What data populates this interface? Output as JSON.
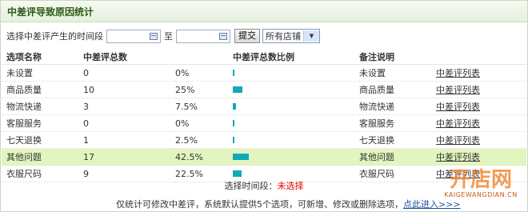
{
  "title": "中差评导致原因统计",
  "filter": {
    "label": "选择中差评产生的时间段",
    "to": "至",
    "submit": "提交",
    "store_select": "所有店铺"
  },
  "columns": [
    "选项名称",
    "中差评总数",
    "中差评总数比例",
    "备注说明"
  ],
  "rows": [
    {
      "name": "未设置",
      "count": "0",
      "percent": "0%",
      "ratio": 0,
      "note": "未设置",
      "link": "中差评列表"
    },
    {
      "name": "商品质量",
      "count": "10",
      "percent": "25%",
      "ratio": 25,
      "note": "商品质量",
      "link": "中差评列表"
    },
    {
      "name": "物流快递",
      "count": "3",
      "percent": "7.5%",
      "ratio": 7.5,
      "note": "物流快递",
      "link": "中差评列表"
    },
    {
      "name": "客服服务",
      "count": "0",
      "percent": "0%",
      "ratio": 0,
      "note": "客服服务",
      "link": "中差评列表"
    },
    {
      "name": "七天退换",
      "count": "1",
      "percent": "2.5%",
      "ratio": 2.5,
      "note": "七天退换",
      "link": "中差评列表"
    },
    {
      "name": "其他问题",
      "count": "17",
      "percent": "42.5%",
      "ratio": 42.5,
      "note": "其他问题",
      "link": "中差评列表",
      "highlight": true
    },
    {
      "name": "衣服尺码",
      "count": "9",
      "percent": "22.5%",
      "ratio": 22.5,
      "note": "衣服尺码",
      "link": "中差评列表"
    }
  ],
  "summary": {
    "label": "选择时间段：",
    "value": "未选择"
  },
  "footer": {
    "text": "仅统计可修改中差评，系统默认提供5个选项，可新增、修改或删除选项，",
    "link": "点此进入>>>"
  },
  "watermark": {
    "logo": "开店网",
    "url": "KAIGEWANGDIAN.CN"
  },
  "colors": {
    "bar": "#13a9b6",
    "highlight_row": "#e2f5bf",
    "title": "#2b5a14"
  }
}
